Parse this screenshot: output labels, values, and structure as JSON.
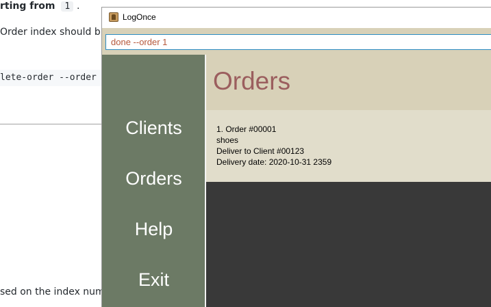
{
  "background_doc": {
    "line1_text": "rting from",
    "line1_code": "1",
    "line1_end": ".",
    "line2_text": "Order index should b",
    "code_line": "lete-order --order",
    "line3_text": "sed on the index num"
  },
  "window": {
    "title": "LogOnce",
    "icon": "app-logo-icon"
  },
  "command": {
    "value": "done --order 1"
  },
  "sidebar": {
    "items": [
      {
        "label": "Clients"
      },
      {
        "label": "Orders"
      },
      {
        "label": "Help"
      },
      {
        "label": "Exit"
      }
    ]
  },
  "main": {
    "title": "Orders",
    "orders": [
      {
        "index_line": "1.   Order #00001",
        "item": "shoes",
        "client": "Deliver to Client #00123",
        "delivery": "Delivery date: 2020-10-31 2359"
      }
    ]
  },
  "colors": {
    "sidebar": "#6c7a65",
    "header": "#d8d1b8",
    "card": "#e1ddcb",
    "title": "#9b5e5e",
    "main_bg": "#393939",
    "input_text": "#b5573a"
  }
}
